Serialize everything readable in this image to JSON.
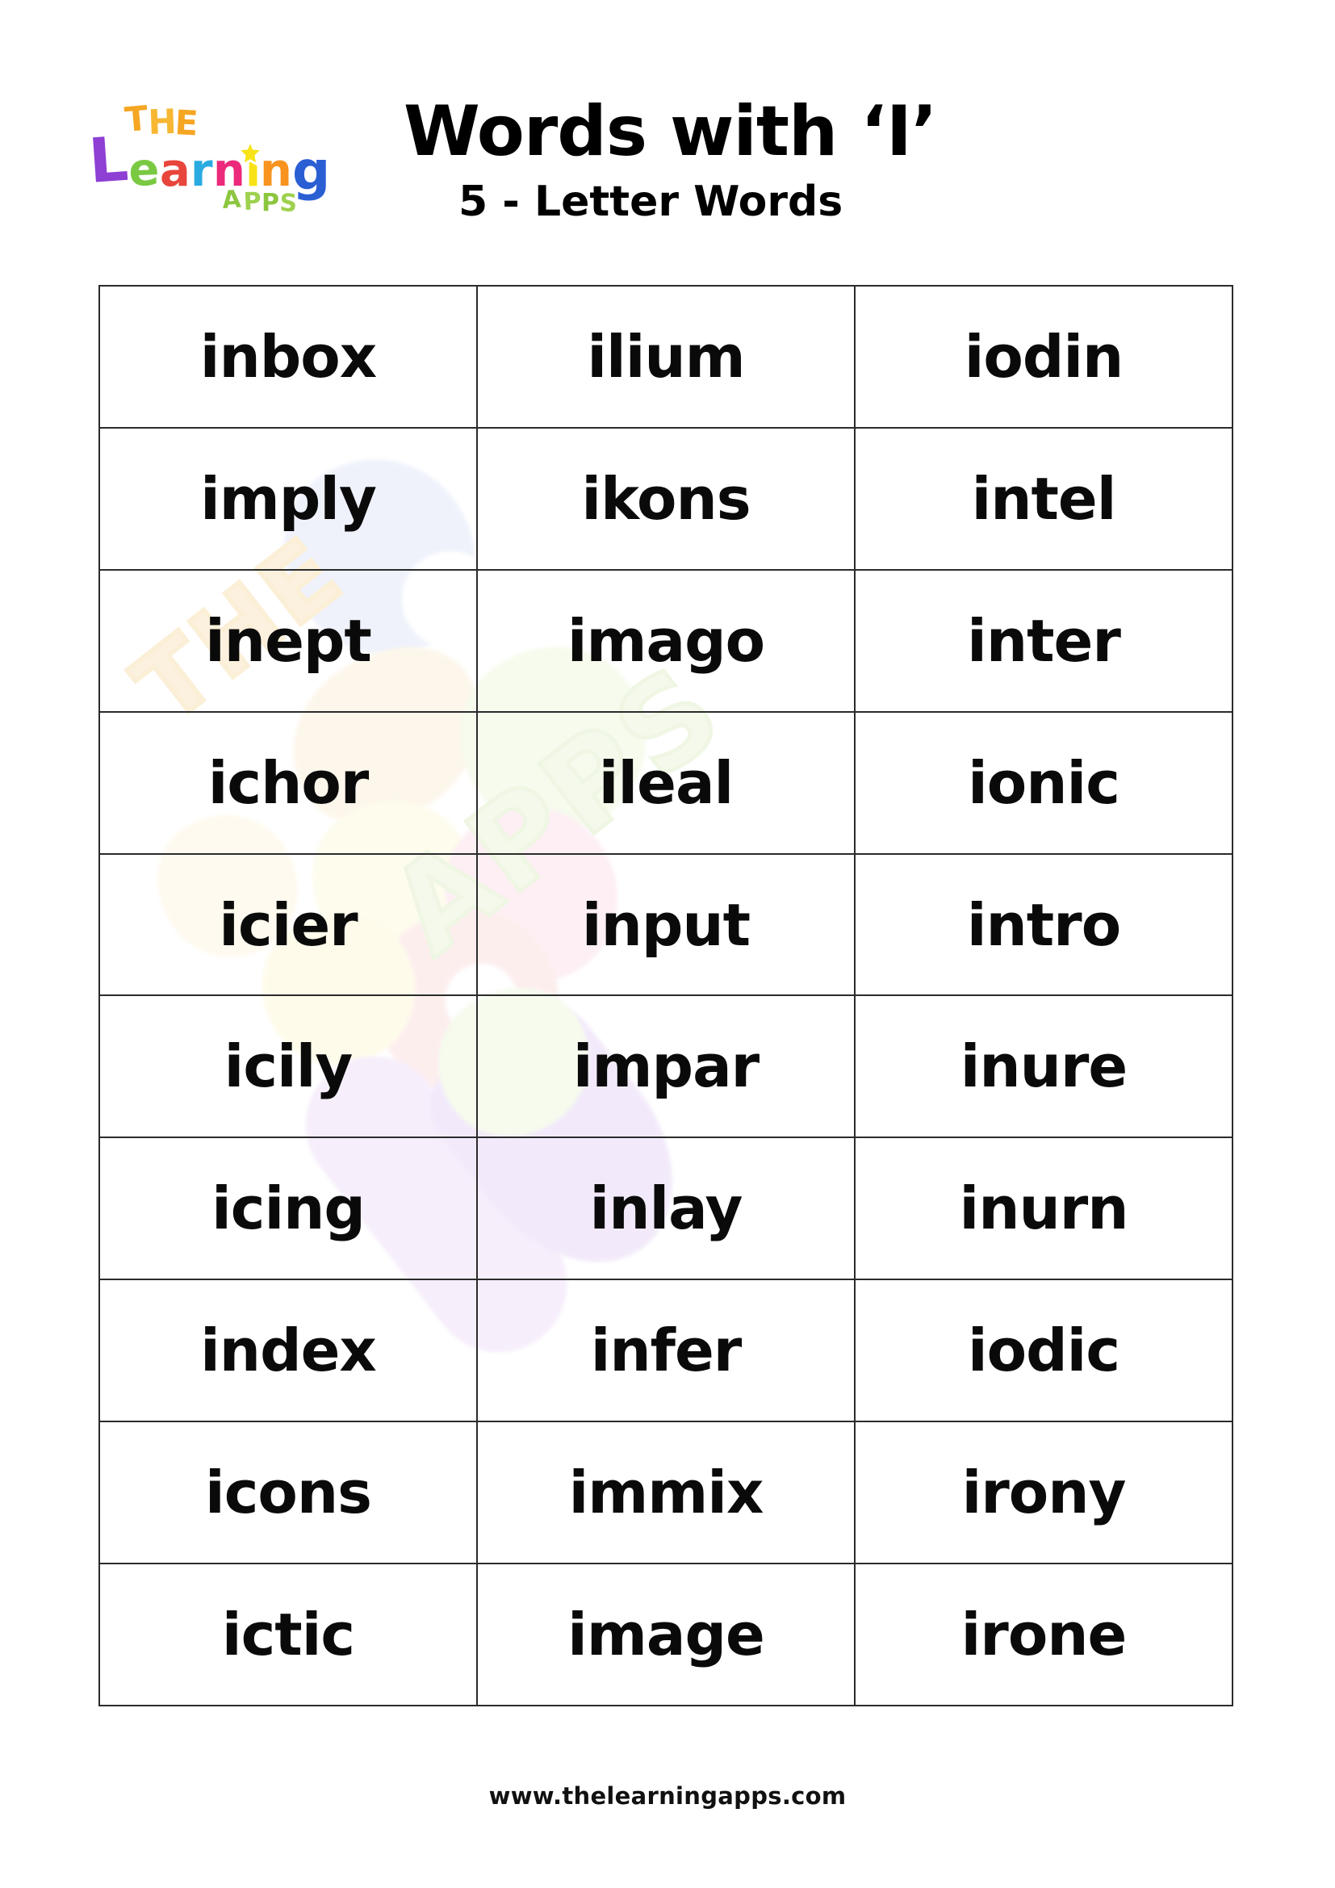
{
  "header": {
    "logo": {
      "name": "the-learning-apps-logo",
      "line_the": "THE",
      "line_learning": "Learning",
      "line_apps": "APPS",
      "colors": {
        "the": "#f5a623",
        "L": "#8e3fd4",
        "e": "#7ac943",
        "a": "#e8453c",
        "r": "#29abe2",
        "n": "#ec297b",
        "i": "#f7e317",
        "n2": "#f7931e",
        "g": "#2a5fd4",
        "apps": "#8cc63f"
      }
    },
    "title": "Words with ‘I’",
    "subtitle": "5 - Letter Words"
  },
  "table": {
    "columns": 3,
    "rows": [
      [
        "inbox",
        "ilium",
        "iodin"
      ],
      [
        "imply",
        "ikons",
        "intel"
      ],
      [
        "inept",
        "imago",
        "inter"
      ],
      [
        "ichor",
        "ileal",
        "ionic"
      ],
      [
        "icier",
        "input",
        "intro"
      ],
      [
        "icily",
        "impar",
        "inure"
      ],
      [
        "icing",
        "inlay",
        "inurn"
      ],
      [
        "index",
        "infer",
        "iodic"
      ],
      [
        "icons",
        "immix",
        "irony"
      ],
      [
        "ictic",
        "image",
        "irone"
      ]
    ]
  },
  "watermark": {
    "text_the": "THE",
    "text_learning": "Learning",
    "text_apps": "APPS"
  },
  "footer": {
    "url": "www.thelearningapps.com"
  },
  "colors": {
    "page_background": "#ffffff",
    "text": "#000000",
    "table_border": "#2b2b2b",
    "word_text": "#0a0a0a"
  }
}
